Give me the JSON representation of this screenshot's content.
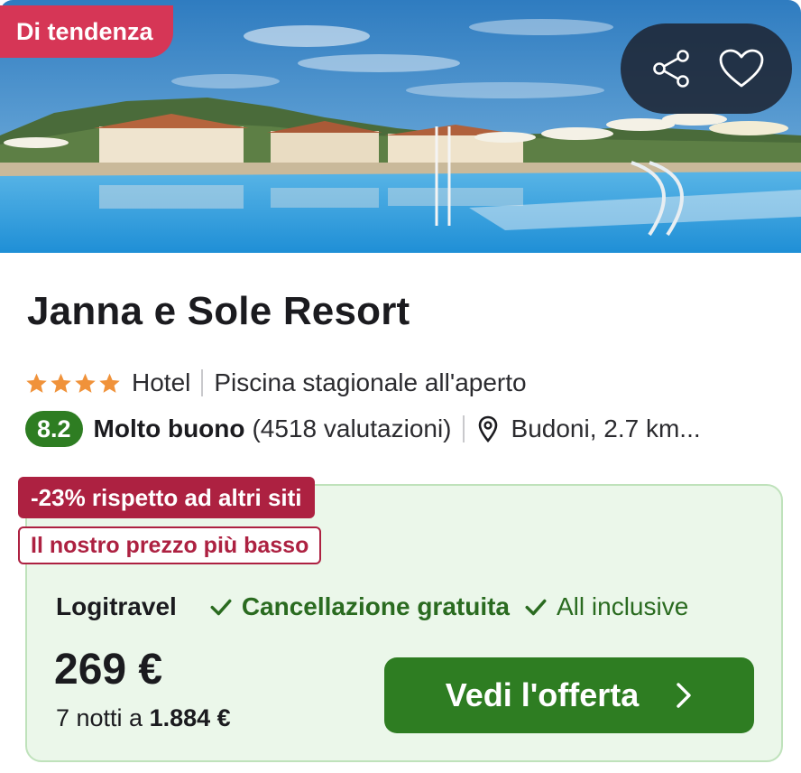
{
  "hero": {
    "badge_label": "Di tendenza",
    "image_icon": "resort-pool-photo"
  },
  "actions": {
    "share_icon": "share-icon",
    "favorite_icon": "heart-icon"
  },
  "hotel": {
    "name": "Janna e Sole Resort",
    "stars": 4,
    "type": "Hotel",
    "amenity": "Piscina stagionale all'aperto",
    "score": "8.2",
    "score_label": "Molto buono",
    "reviews": "(4518 valutazioni)",
    "location": "Budoni, 2.7 km..."
  },
  "deal": {
    "discount_badge": "-23% rispetto ad altri siti",
    "lowest_badge": "Il nostro prezzo più basso",
    "provider": "Logitravel",
    "feature_1": "Cancellazione gratuita",
    "feature_2": "All inclusive",
    "price": "269 €",
    "nights_prefix": "7 notti a",
    "total": "1.884 €",
    "cta_label": "Vedi l'offerta"
  },
  "colors": {
    "trend": "#d63656",
    "discount": "#ad2141",
    "green": "#2e7d22",
    "deal_bg": "#ebf7ea",
    "star": "#f0923a"
  }
}
